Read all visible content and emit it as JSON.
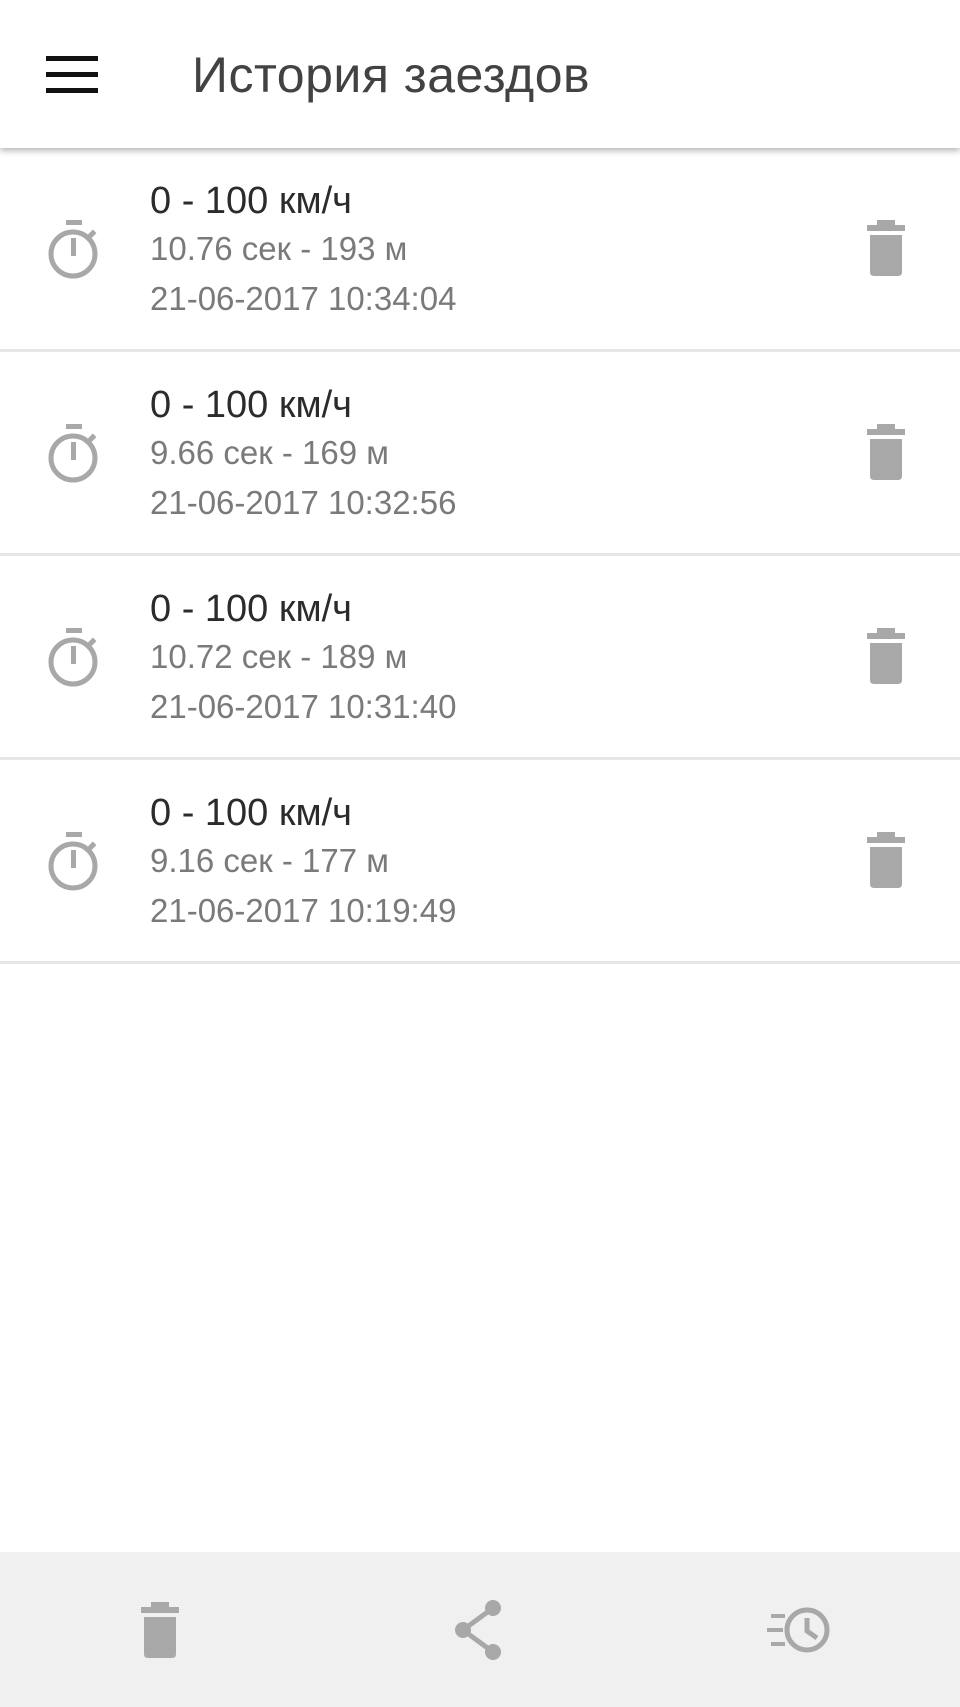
{
  "app_bar": {
    "title": "История заездов",
    "menu_icon": "menu-icon"
  },
  "runs": [
    {
      "title": "0 - 100 км/ч",
      "result": "10.76 сек - 193 м",
      "datetime": "21-06-2017 10:34:04"
    },
    {
      "title": "0 - 100 км/ч",
      "result": "9.66 сек - 169 м",
      "datetime": "21-06-2017 10:32:56"
    },
    {
      "title": "0 - 100 км/ч",
      "result": "10.72 сек - 189 м",
      "datetime": "21-06-2017 10:31:40"
    },
    {
      "title": "0 - 100 км/ч",
      "result": "9.16 сек - 177 м",
      "datetime": "21-06-2017 10:19:49"
    }
  ],
  "bottom_bar": {
    "icons": [
      "delete-icon",
      "share-icon",
      "history-icon"
    ]
  },
  "colors": {
    "icon_gray": "#a8a8a8",
    "bottom_bar_bg": "#f0f0f0",
    "title_text": "#424242",
    "subtitle_text": "#7a7a7a"
  }
}
